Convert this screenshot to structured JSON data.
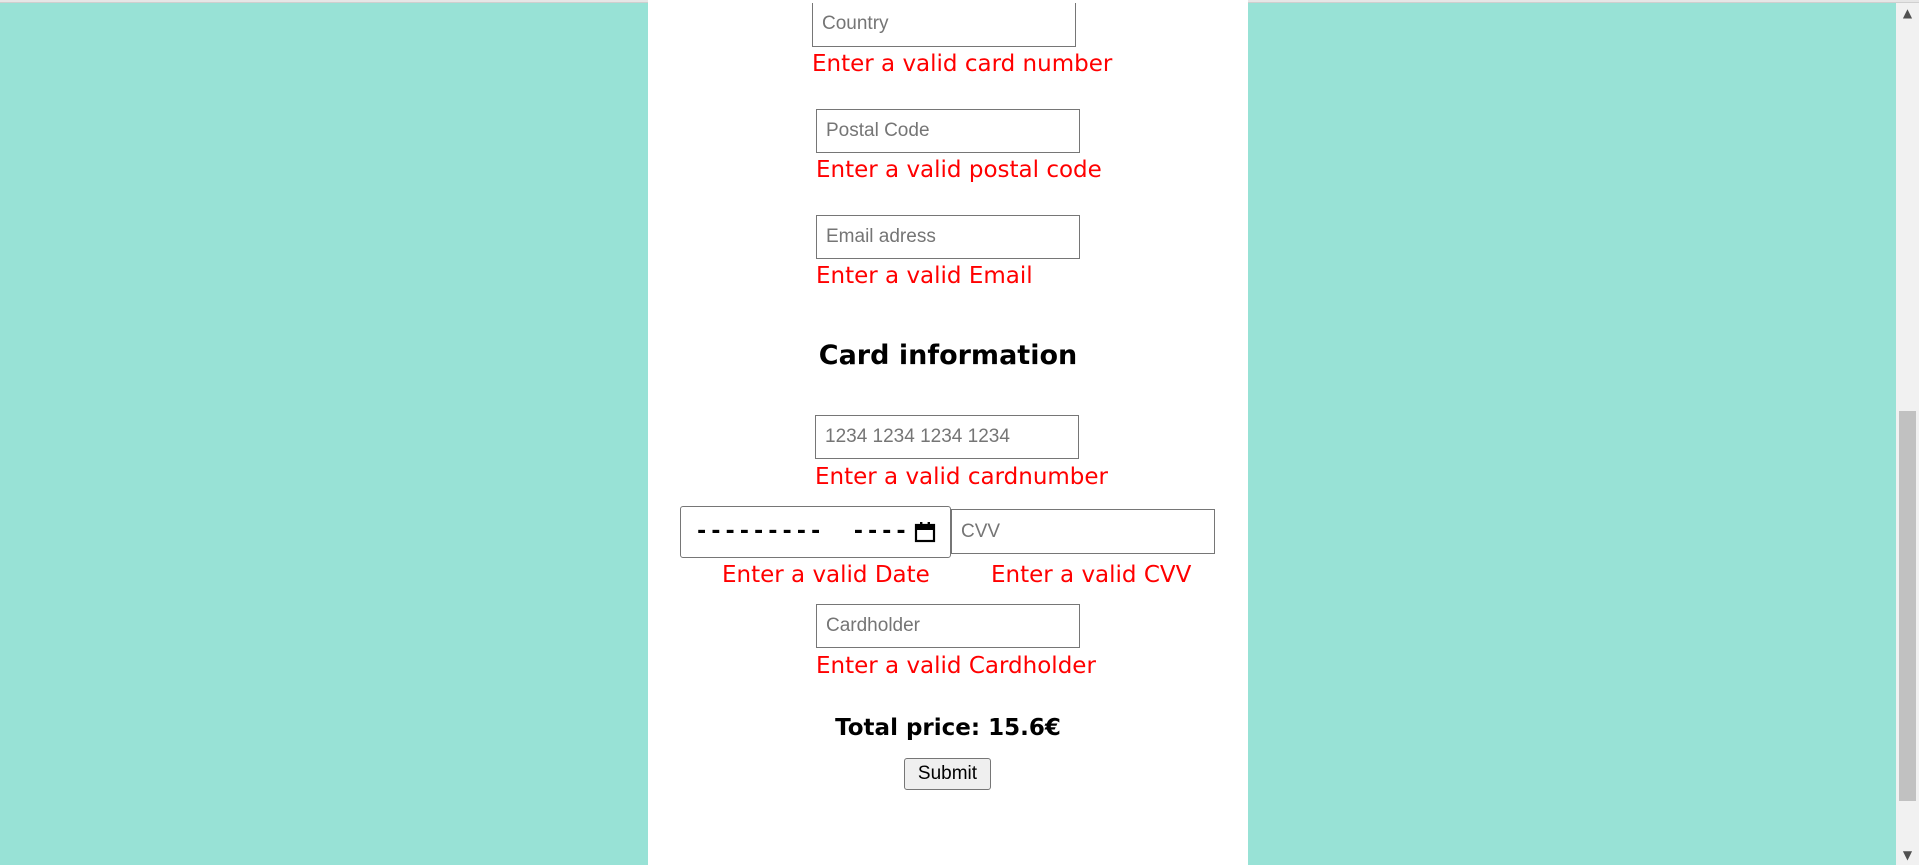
{
  "form": {
    "country": {
      "placeholder": "Country",
      "error": "Enter a valid card number"
    },
    "postal_code": {
      "placeholder": "Postal Code",
      "error": "Enter a valid postal code"
    },
    "email": {
      "placeholder": "Email adress",
      "error": "Enter a valid Email"
    }
  },
  "card": {
    "heading": "Card information",
    "number": {
      "placeholder": "1234 1234 1234 1234",
      "error": "Enter a valid cardnumber"
    },
    "date": {
      "mask": "---------  ----",
      "error": "Enter a valid Date"
    },
    "cvv": {
      "placeholder": "CVV",
      "error": "Enter a valid CVV"
    },
    "holder": {
      "placeholder": "Cardholder",
      "error": "Enter a valid Cardholder"
    }
  },
  "total": {
    "text": "Total price: 15.6€"
  },
  "submit_label": "Submit",
  "colors": {
    "background": "#98e2d6",
    "panel": "#ffffff",
    "error": "#ff0000"
  },
  "icons": {
    "date_picker": "calendar-icon",
    "scroll_up": "arrow-up-icon",
    "scroll_down": "arrow-down-icon"
  }
}
